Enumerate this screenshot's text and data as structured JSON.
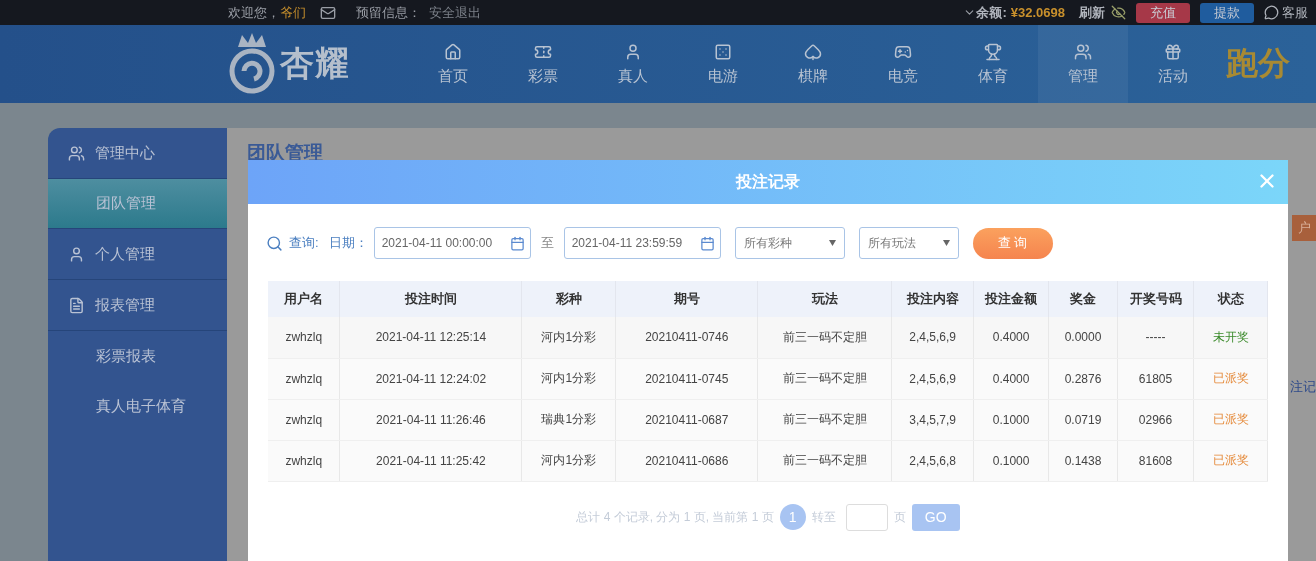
{
  "top_bar": {
    "greeting": "欢迎您，",
    "username": "爷们",
    "reserved_label": "预留信息：",
    "logout": "安全退出",
    "balance_label": "余额:",
    "balance": "¥32.0698",
    "refresh": "刷新",
    "deposit": "充值",
    "withdraw": "提款",
    "service": "客服"
  },
  "nav": {
    "logo": "杏耀",
    "items": [
      {
        "label": "首页",
        "selected": false
      },
      {
        "label": "彩票",
        "selected": false
      },
      {
        "label": "真人",
        "selected": false
      },
      {
        "label": "电游",
        "selected": false
      },
      {
        "label": "棋牌",
        "selected": false
      },
      {
        "label": "电竞",
        "selected": false
      },
      {
        "label": "体育",
        "selected": false
      },
      {
        "label": "管理",
        "selected": true
      },
      {
        "label": "活动",
        "selected": false
      }
    ],
    "promo": "跑分"
  },
  "sidebar": {
    "sections": [
      {
        "label": "管理中心",
        "children": [
          {
            "label": "团队管理",
            "selected": true
          }
        ]
      },
      {
        "label": "个人管理"
      },
      {
        "label": "报表管理",
        "children": [
          {
            "label": "彩票报表",
            "selected": false
          },
          {
            "label": "真人电子体育",
            "selected": false
          }
        ]
      }
    ]
  },
  "page": {
    "title": "团队管理",
    "side_button": "户",
    "side_link": "注记"
  },
  "dialog": {
    "title": "投注记录",
    "query": {
      "label": "查询:",
      "date_label": "日期：",
      "from": "2021-04-11 00:00:00",
      "to_label": "至",
      "to": "2021-04-11 23:59:59",
      "lottery": "所有彩种",
      "play": "所有玩法",
      "button": "查 询"
    },
    "table": {
      "columns": [
        "用户名",
        "投注时间",
        "彩种",
        "期号",
        "玩法",
        "投注内容",
        "投注金额",
        "奖金",
        "开奖号码",
        "状态"
      ],
      "rows": [
        {
          "cells": [
            "zwhzlq",
            "2021-04-11 12:25:14",
            "河内1分彩",
            "20210411-0746",
            "前三一码不定胆",
            "2,4,5,6,9",
            "0.4000",
            "0.0000",
            "-----"
          ],
          "status": {
            "text": "未开奖",
            "kind": "pending"
          }
        },
        {
          "cells": [
            "zwhzlq",
            "2021-04-11 12:24:02",
            "河内1分彩",
            "20210411-0745",
            "前三一码不定胆",
            "2,4,5,6,9",
            "0.4000",
            "0.2876",
            "61805"
          ],
          "status": {
            "text": "已派奖",
            "kind": "paid"
          }
        },
        {
          "cells": [
            "zwhzlq",
            "2021-04-11 11:26:46",
            "瑞典1分彩",
            "20210411-0687",
            "前三一码不定胆",
            "3,4,5,7,9",
            "0.1000",
            "0.0719",
            "02966"
          ],
          "status": {
            "text": "已派奖",
            "kind": "paid"
          }
        },
        {
          "cells": [
            "zwhzlq",
            "2021-04-11 11:25:42",
            "河内1分彩",
            "20210411-0686",
            "前三一码不定胆",
            "2,4,5,6,8",
            "0.1000",
            "0.1438",
            "81608"
          ],
          "status": {
            "text": "已派奖",
            "kind": "paid"
          }
        }
      ]
    },
    "pagination": {
      "summary": "总计 4 个记录, 分为 1 页, 当前第 1 页",
      "pages": [
        {
          "label": "1",
          "selected": true
        }
      ],
      "goto_label": "转至",
      "page_unit": "页",
      "go": "GO"
    }
  }
}
